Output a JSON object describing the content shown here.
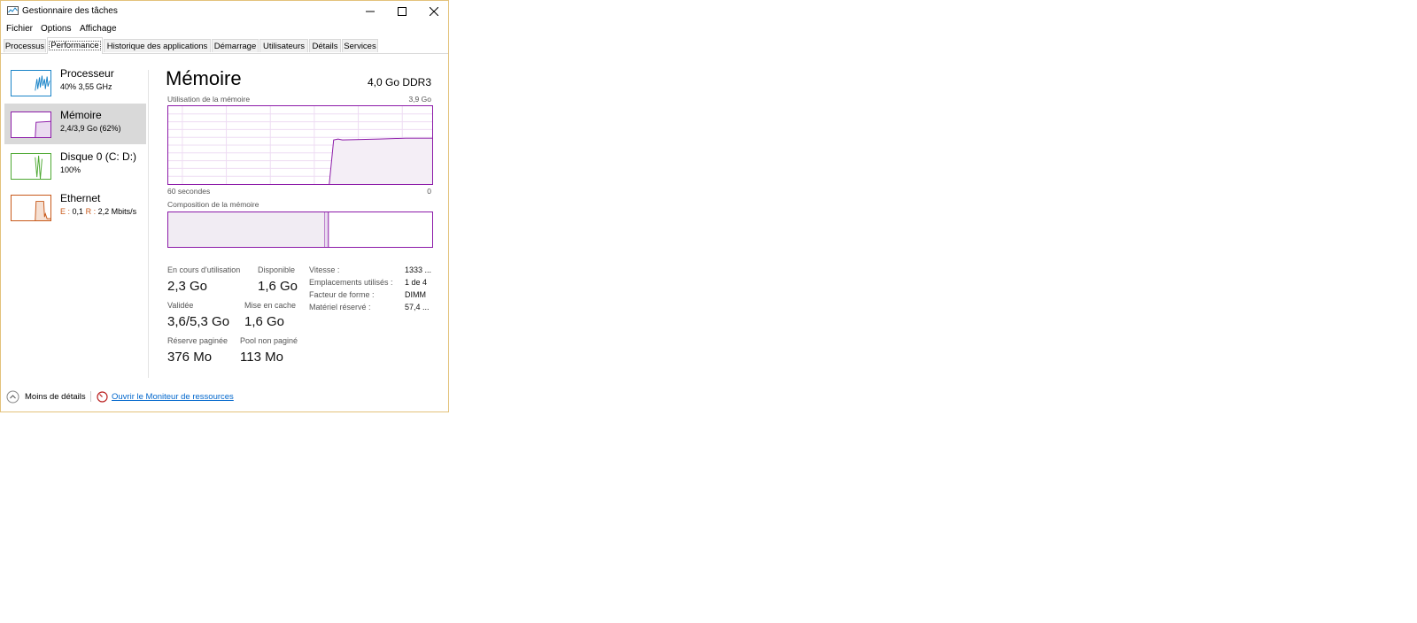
{
  "window": {
    "title": "Gestionnaire des tâches"
  },
  "menu": [
    {
      "label": "Fichier"
    },
    {
      "label": "Options"
    },
    {
      "label": "Affichage"
    }
  ],
  "tabs": [
    {
      "label": "Processus"
    },
    {
      "label": "Performance"
    },
    {
      "label": "Historique des applications"
    },
    {
      "label": "Démarrage"
    },
    {
      "label": "Utilisateurs"
    },
    {
      "label": "Détails"
    },
    {
      "label": "Services"
    }
  ],
  "sidebar": [
    {
      "name": "Processeur",
      "sub": "40%  3,55 GHz",
      "color": "#1a84c8"
    },
    {
      "name": "Mémoire",
      "sub": "2,4/3,9 Go (62%)",
      "color": "#8c1aa8"
    },
    {
      "name": "Disque 0 (C: D:)",
      "sub": "100%",
      "color": "#4da832"
    },
    {
      "name": "Ethernet",
      "sub_prefix_e": "E :",
      "sub_value_e": "0,1",
      "sub_prefix_r": "R :",
      "sub_value_r": "2,2 Mbits/s",
      "color": "#c8591a"
    }
  ],
  "main": {
    "title": "Mémoire",
    "spec": "4,0 Go DDR3",
    "usage_graph": {
      "label": "Utilisation de la mémoire",
      "max_label": "3,9 Go",
      "left_axis": "60 secondes",
      "right_axis": "0"
    },
    "composition": {
      "label": "Composition de la mémoire"
    },
    "stats": {
      "in_use_label": "En cours d'utilisation",
      "in_use_value": "2,3 Go",
      "available_label": "Disponible",
      "available_value": "1,6 Go",
      "committed_label": "Validée",
      "committed_value": "3,6/5,3 Go",
      "cached_label": "Mise en cache",
      "cached_value": "1,6 Go",
      "paged_label": "Réserve paginée",
      "paged_value": "376 Mo",
      "nonpaged_label": "Pool non paginé",
      "nonpaged_value": "113 Mo"
    },
    "details": [
      {
        "label": "Vitesse :",
        "value": "1333 ..."
      },
      {
        "label": "Emplacements utilisés :",
        "value": "1 de 4"
      },
      {
        "label": "Facteur de forme :",
        "value": "DIMM"
      },
      {
        "label": "Matériel réservé :",
        "value": "57,4 ..."
      }
    ]
  },
  "footer": {
    "less_details": "Moins de détails",
    "resource_monitor": "Ouvrir le Moniteur de ressources"
  }
}
